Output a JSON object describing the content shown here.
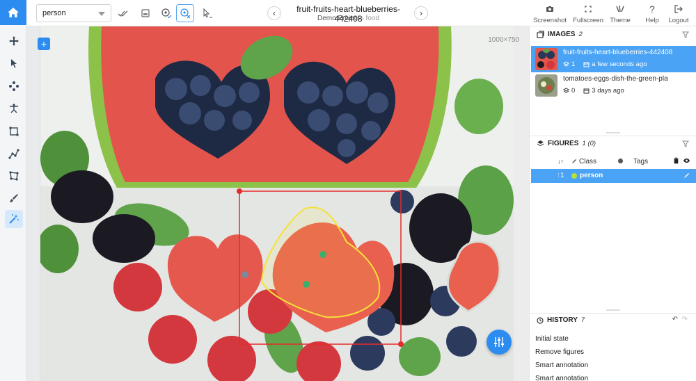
{
  "toolbar": {
    "class_value": "person"
  },
  "header": {
    "image_title": "fruit-fruits-heart-blueberries-442408",
    "project": "Demo Project",
    "breadcrumb_separator": "›",
    "dataset": "food",
    "actions": [
      {
        "label": "Screenshot",
        "icon": "camera-icon"
      },
      {
        "label": "Fullscreen",
        "icon": "fullscreen-icon"
      },
      {
        "label": "Theme",
        "icon": "theme-icon"
      },
      {
        "label": "Help",
        "icon": "help-icon"
      },
      {
        "label": "Logout",
        "icon": "logout-icon"
      }
    ]
  },
  "canvas": {
    "resolution": "1000×750",
    "add_label": "+"
  },
  "images_panel": {
    "title": "IMAGES",
    "count": "2",
    "items": [
      {
        "name": "fruit-fruits-heart-blueberries-442408",
        "figures": "1",
        "time": "a few seconds ago",
        "selected": true
      },
      {
        "name": "tomatoes-eggs-dish-the-green-pla",
        "figures": "0",
        "time": "3 days ago",
        "selected": false
      }
    ]
  },
  "figures_panel": {
    "title": "FIGURES",
    "count": "1 (0)",
    "col_class": "Class",
    "col_tags": "Tags",
    "rows": [
      {
        "index": "1",
        "class": "person",
        "color": "#b6e33a"
      }
    ]
  },
  "history_panel": {
    "title": "HISTORY",
    "count": "7",
    "items": [
      "Initial state",
      "Remove figures",
      "Smart annotation",
      "Smart annotation"
    ]
  },
  "colors": {
    "accent": "#2d8cf0",
    "selection": "#4aa3f4",
    "bbox": "#e52b2b",
    "polygon": "#f5e13a"
  }
}
